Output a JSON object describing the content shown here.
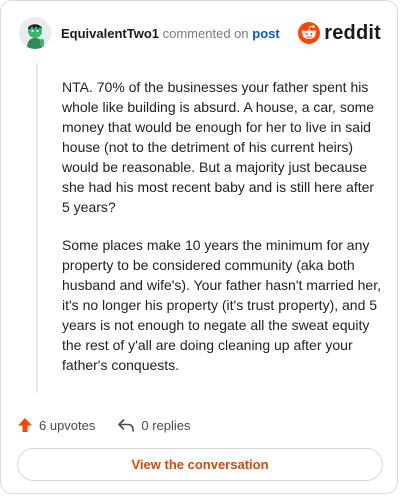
{
  "header": {
    "username": "EquivalentTwo1",
    "commented_on": "commented on",
    "post_link": "post",
    "brand_name": "reddit",
    "brand_color": "#ff4500"
  },
  "comment": {
    "paragraphs": [
      "NTA. 70% of the businesses your father spent his whole like building is absurd. A house, a car, some money that would be enough for her to live in said house (not to the detriment of his current heirs) would be reasonable. But a majority just because she had his most recent baby and is still here after 5 years?",
      "Some places make 10 years the minimum for any property to be considered community (aka both husband and wife's). Your father hasn't married her, it's no longer his property (it's trust property), and 5 years is not enough to negate all the sweat equity the rest of y'all are doing cleaning up after your father's conquests."
    ]
  },
  "actions": {
    "upvotes": "6 upvotes",
    "replies": "0 replies",
    "upvote_color": "#ff4500"
  },
  "footer": {
    "view_button": "View the conversation"
  },
  "icons": [
    "avatar",
    "reddit-logo-icon",
    "upvote-arrow-icon",
    "reply-arrow-icon"
  ]
}
